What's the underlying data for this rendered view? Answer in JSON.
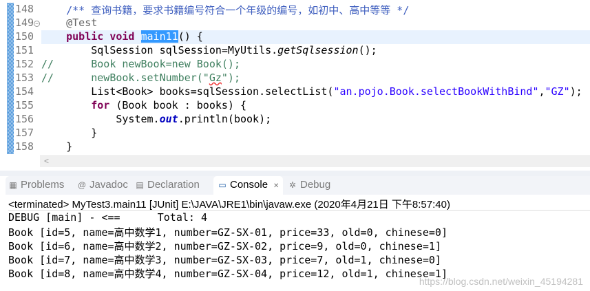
{
  "editor": {
    "line_numbers": [
      "148",
      "149",
      "150",
      "151",
      "152",
      "153",
      "154",
      "155",
      "156",
      "157",
      "158"
    ],
    "lines": [
      [
        {
          "t": "    "
        },
        {
          "t": "/** 查询书籍，要求书籍编号符合一个年级的编号，如初中、高中等等 */",
          "c": "cm"
        }
      ],
      [
        {
          "t": "    "
        },
        {
          "t": "@Test",
          "c": "ann"
        }
      ],
      [
        {
          "t": "    "
        },
        {
          "t": "public",
          "c": "kw"
        },
        {
          "t": " "
        },
        {
          "t": "void",
          "c": "kw"
        },
        {
          "t": " "
        },
        {
          "t": "main11",
          "c": "sel"
        },
        {
          "t": "() {"
        }
      ],
      [
        {
          "t": "        SqlSession sqlSession=MyUtils."
        },
        {
          "t": "getSqlsession",
          "c": "it"
        },
        {
          "t": "();"
        }
      ],
      [
        {
          "t": "//      Book newBook=new Book();",
          "c": "lc"
        }
      ],
      [
        {
          "t": "//      newBook.setNumber(\"",
          "c": "lc"
        },
        {
          "t": "Gz",
          "c": "lc sq"
        },
        {
          "t": "\");",
          "c": "lc"
        }
      ],
      [
        {
          "t": "        List<Book> books=sqlSession.selectList("
        },
        {
          "t": "\"an.pojo.Book.selectBookWithBind\"",
          "c": "str"
        },
        {
          "t": ","
        },
        {
          "t": "\"GZ\"",
          "c": "str"
        },
        {
          "t": ");"
        }
      ],
      [
        {
          "t": "        "
        },
        {
          "t": "for",
          "c": "kw"
        },
        {
          "t": " (Book book : books) {"
        }
      ],
      [
        {
          "t": "            System."
        },
        {
          "t": "out",
          "c": "fld"
        },
        {
          "t": ".println(book);"
        }
      ],
      [
        {
          "t": "        }"
        }
      ],
      [
        {
          "t": "    }"
        }
      ]
    ],
    "current_line_index": 2,
    "scroll_left_arrow": "<"
  },
  "tabs": [
    {
      "label": "Problems",
      "icon": "problems-icon",
      "glyph": "▦",
      "active": false
    },
    {
      "label": "Javadoc",
      "icon": "javadoc-icon",
      "glyph": "@",
      "active": false
    },
    {
      "label": "Declaration",
      "icon": "declaration-icon",
      "glyph": "▤",
      "active": false
    },
    {
      "label": "Console",
      "icon": "console-icon",
      "glyph": "▭",
      "active": true,
      "close": "✕"
    },
    {
      "label": "Debug",
      "icon": "debug-icon",
      "glyph": "✲",
      "active": false
    }
  ],
  "console": {
    "status": "<terminated> MyTest3.main11 [JUnit] E:\\JAVA\\JRE1\\bin\\javaw.exe (2020年4月21日 下午8:57:40)",
    "output": [
      "DEBUG [main] - <==      Total: 4",
      "Book [id=5, name=高中数学1, number=GZ-SX-01, price=33, old=0, chinese=0]",
      "Book [id=6, name=高中数学2, number=GZ-SX-02, price=9, old=0, chinese=1]",
      "Book [id=7, name=高中数学3, number=GZ-SX-03, price=7, old=1, chinese=0]",
      "Book [id=8, name=高中数学4, number=GZ-SX-04, price=12, old=1, chinese=1]"
    ]
  },
  "watermark": "https://blog.csdn.net/weixin_45194281"
}
